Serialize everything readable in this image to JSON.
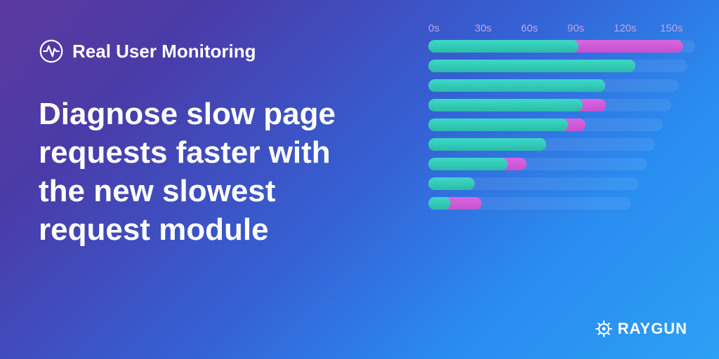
{
  "header": {
    "title": "Real User Monitoring"
  },
  "headline": "Diagnose slow page requests faster with the new slowest request module",
  "footer": {
    "brand": "RAYGUN"
  },
  "chart_data": {
    "type": "bar",
    "xlabel": "",
    "ylabel": "",
    "xlim": [
      0,
      160
    ],
    "ticks": [
      "0s",
      "30s",
      "60s",
      "90s",
      "120s",
      "150s"
    ],
    "series": [
      {
        "name": "primary",
        "color": "#2bbca8"
      },
      {
        "name": "secondary",
        "color": "#c850d0"
      }
    ],
    "rows": [
      {
        "teal": 90,
        "magenta": 153
      },
      {
        "teal": 128,
        "magenta": 128
      },
      {
        "teal": 113,
        "magenta": 113
      },
      {
        "teal": 102,
        "magenta": 117
      },
      {
        "teal": 95,
        "magenta": 107
      },
      {
        "teal": 83,
        "magenta": 83
      },
      {
        "teal": 58,
        "magenta": 72
      },
      {
        "teal": 35,
        "magenta": 35
      },
      {
        "teal": 18,
        "magenta": 42
      }
    ]
  }
}
